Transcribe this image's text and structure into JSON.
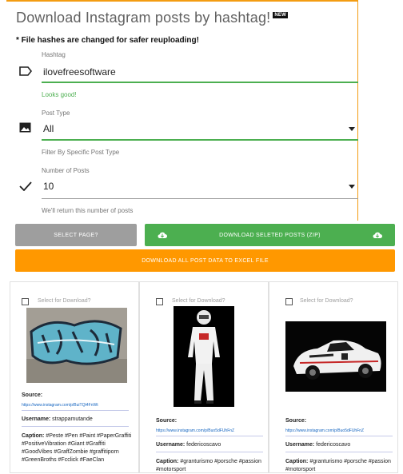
{
  "header": {
    "title": "Download Instagram posts by hashtag!",
    "badge": "NEW",
    "note": "* File hashes are changed for safer reuploading!"
  },
  "form": {
    "hashtag": {
      "label": "Hashtag",
      "value": "ilovefreesoftware",
      "helper": "Looks good!"
    },
    "post_type": {
      "label": "Post Type",
      "value": "All",
      "helper": "Filter By Specific Post Type"
    },
    "num_posts": {
      "label": "Number of Posts",
      "value": "10",
      "helper": "We'll return this number of posts"
    }
  },
  "buttons": {
    "select_page": "SELECT PAGE?",
    "download_selected": "DOWNLOAD SELETED POSTS (ZIP)",
    "download_excel": "DOWNLOAD ALL POST DATA TO EXCEL FILE"
  },
  "cards": [
    {
      "select_label": "Select for Download?",
      "source_label": "Source:",
      "source_url": "https://www.instagram.com/p/BuiTQt4FnWt",
      "username_label": "Username:",
      "username": "strappamutande",
      "caption_label": "Caption:",
      "caption": "#Peste #Pen #Paint #PaperGraffiti #PositiveVibration #Giant #Graffiti #GoodVibes #GraffZombie #graffitiporn #GreenBroths #Fcclick #FaeClan"
    },
    {
      "select_label": "Select for Download?",
      "source_label": "Source:",
      "source_url": "https://www.instagram.com/p/Buo5dFUhFnZ",
      "username_label": "Username:",
      "username": "federicoscavo",
      "caption_label": "Caption:",
      "caption": "#granturismo #porsche #passion #motorsport"
    },
    {
      "select_label": "Select for Download?",
      "source_label": "Source:",
      "source_url": "https://www.instagram.com/p/Buo5dFUhFnZ",
      "username_label": "Username:",
      "username": "federicoscavo",
      "caption_label": "Caption:",
      "caption": "#granturismo #porsche #passion #motorsport"
    }
  ],
  "colors": {
    "accent": "#ff9800",
    "success": "#4caf50",
    "muted": "#9e9e9e",
    "link": "#1565c0"
  },
  "icons": [
    "label-outline-icon",
    "image-icon",
    "check-icon",
    "caret-down-icon",
    "cloud-download-icon"
  ]
}
